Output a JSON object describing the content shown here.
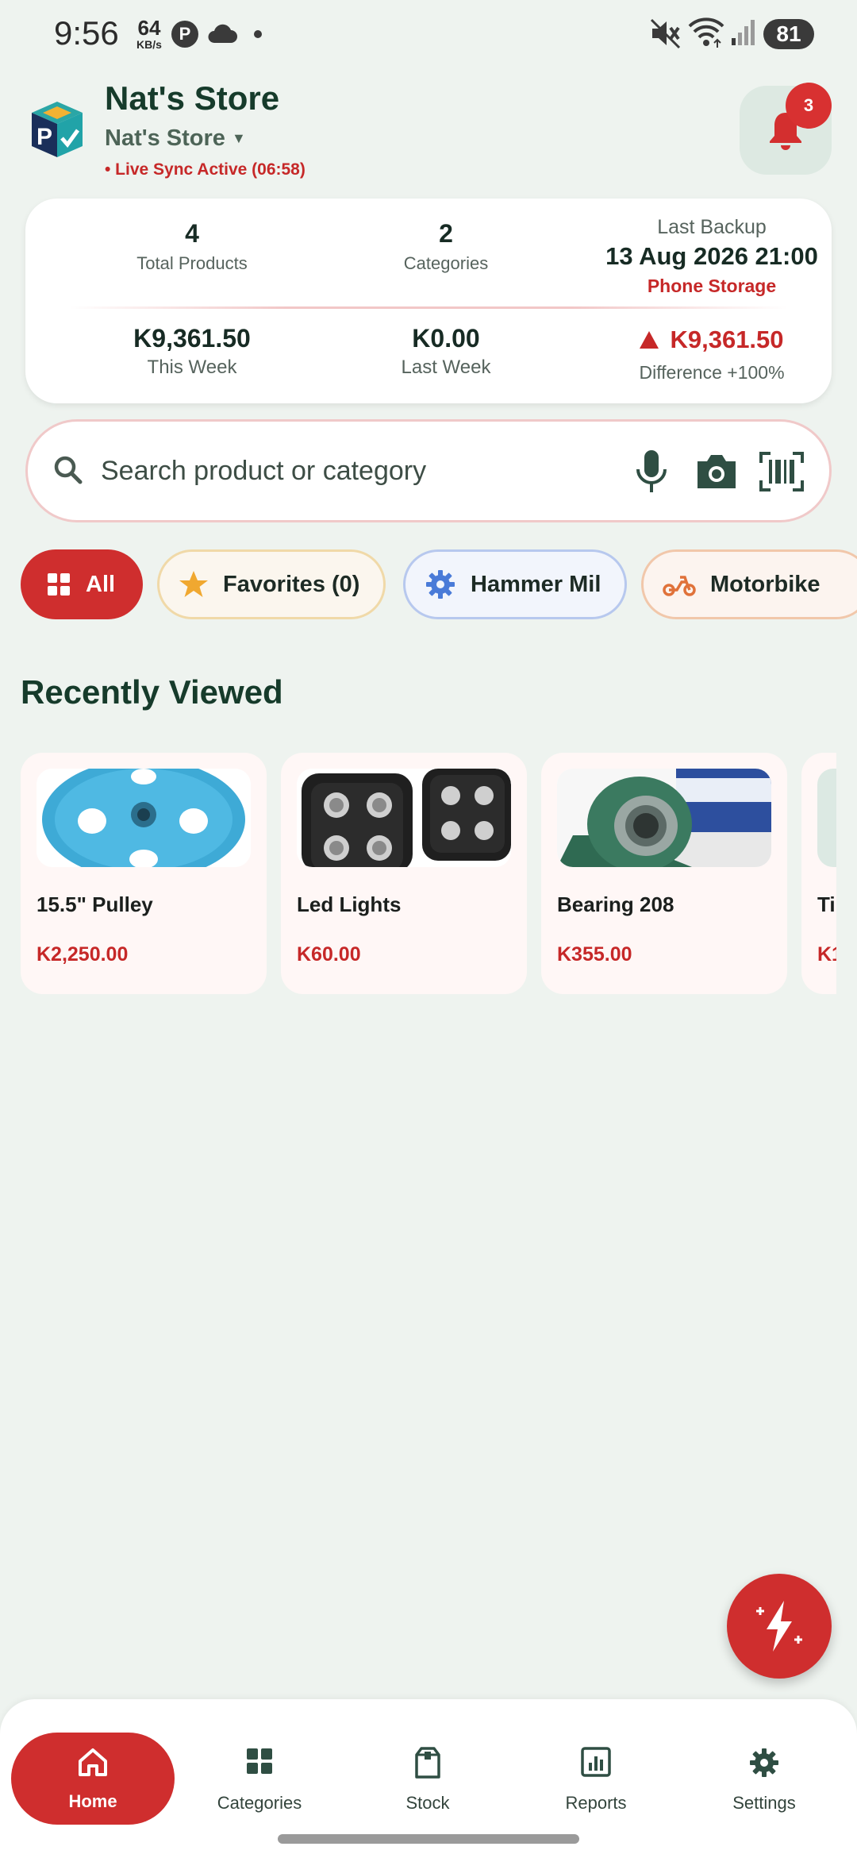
{
  "status_bar": {
    "time": "9:56",
    "net_speed": "64",
    "net_unit": "KB/s",
    "p_badge": "P",
    "battery": "81",
    "icons": [
      "cloud-icon",
      "mute-icon",
      "wifi-icon",
      "signal-icon",
      "battery-icon"
    ]
  },
  "header": {
    "title": "Nat's Store",
    "store_selector": "Nat's Store",
    "sync_status": "• Live Sync Active (06:58)",
    "notification_count": "3"
  },
  "stats": {
    "total_products_value": "4",
    "total_products_label": "Total Products",
    "categories_value": "2",
    "categories_label": "Categories",
    "last_backup_label": "Last Backup",
    "last_backup_date": "13 Aug 2026 21:00",
    "backup_location": "Phone Storage",
    "this_week_value": "K9,361.50",
    "this_week_label": "This Week",
    "last_week_value": "K0.00",
    "last_week_label": "Last Week",
    "difference_value": "K9,361.50",
    "difference_label": "Difference +100%"
  },
  "search": {
    "placeholder": "Search product or category"
  },
  "filters": [
    {
      "label": "All",
      "icon": "grid-icon"
    },
    {
      "label": "Favorites (0)",
      "icon": "star-icon"
    },
    {
      "label": "Hammer Mil",
      "icon": "gear-icon"
    },
    {
      "label": "Motorbike",
      "icon": "motorbike-icon"
    }
  ],
  "recently_viewed": {
    "title": "Recently Viewed",
    "items": [
      {
        "name": "15.5\" Pulley",
        "price": "K2,250.00"
      },
      {
        "name": "Led Lights",
        "price": "K60.00"
      },
      {
        "name": "Bearing 208",
        "price": "K355.00"
      },
      {
        "name": "Ti",
        "price": "K1"
      }
    ]
  },
  "bottom_nav": [
    {
      "label": "Home",
      "icon": "home-icon",
      "active": true
    },
    {
      "label": "Categories",
      "icon": "grid-icon",
      "active": false
    },
    {
      "label": "Stock",
      "icon": "box-icon",
      "active": false
    },
    {
      "label": "Reports",
      "icon": "bar-chart-icon",
      "active": false
    },
    {
      "label": "Settings",
      "icon": "gear-icon",
      "active": false
    }
  ],
  "colors": {
    "accent_red": "#cf2e2e",
    "dark_green": "#163b2b",
    "background": "#eef3ef"
  }
}
